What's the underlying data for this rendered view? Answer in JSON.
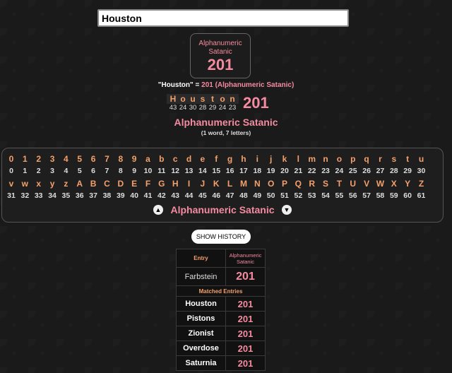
{
  "search": {
    "value": "Houston"
  },
  "cipher_box": {
    "name": "Alphanumeric Satanic",
    "value": "201"
  },
  "equation": {
    "phrase": "\"Houston\"",
    "equals": " = ",
    "result": "201 (Alphanumeric Satanic)"
  },
  "breakdown": {
    "letters": [
      "H",
      "o",
      "u",
      "s",
      "t",
      "o",
      "n"
    ],
    "values": [
      "43",
      "24",
      "30",
      "28",
      "29",
      "24",
      "23"
    ],
    "total": "201"
  },
  "cipher_name": "Alphanumeric Satanic",
  "word_count": "(1 word, 7 letters)",
  "chart": {
    "row1_chars": [
      "0",
      "1",
      "2",
      "3",
      "4",
      "5",
      "6",
      "7",
      "8",
      "9",
      "a",
      "b",
      "c",
      "d",
      "e",
      "f",
      "g",
      "h",
      "i",
      "j",
      "k",
      "l",
      "m",
      "n",
      "o",
      "p",
      "q",
      "r",
      "s",
      "t",
      "u"
    ],
    "row1_vals": [
      "0",
      "1",
      "2",
      "3",
      "4",
      "5",
      "6",
      "7",
      "8",
      "9",
      "10",
      "11",
      "12",
      "13",
      "14",
      "15",
      "16",
      "17",
      "18",
      "19",
      "20",
      "21",
      "22",
      "23",
      "24",
      "25",
      "26",
      "27",
      "28",
      "29",
      "30"
    ],
    "row2_chars": [
      "v",
      "w",
      "x",
      "y",
      "z",
      "A",
      "B",
      "C",
      "D",
      "E",
      "F",
      "G",
      "H",
      "I",
      "J",
      "K",
      "L",
      "M",
      "N",
      "O",
      "P",
      "Q",
      "R",
      "S",
      "T",
      "U",
      "V",
      "W",
      "X",
      "Y",
      "Z"
    ],
    "row2_vals": [
      "31",
      "32",
      "33",
      "34",
      "35",
      "36",
      "37",
      "38",
      "39",
      "40",
      "41",
      "42",
      "43",
      "44",
      "45",
      "46",
      "47",
      "48",
      "49",
      "50",
      "51",
      "52",
      "53",
      "54",
      "55",
      "56",
      "57",
      "58",
      "59",
      "60",
      "61"
    ],
    "title": "Alphanumeric Satanic",
    "prev_icon": "chevron-up-icon",
    "next_icon": "chevron-down-icon"
  },
  "history_button": "SHOW HISTORY",
  "history": {
    "col_entry": "Entry",
    "col_cipher": "Alphanumeric Satanic",
    "main": {
      "word": "Farbstein",
      "value": "201"
    },
    "matched_label": "Matched Entries",
    "matches": [
      {
        "word": "Houston",
        "value": "201"
      },
      {
        "word": "Pistons",
        "value": "201"
      },
      {
        "word": "Zionist",
        "value": "201"
      },
      {
        "word": "Overdose",
        "value": "201"
      },
      {
        "word": "Saturnia",
        "value": "201"
      }
    ]
  },
  "colors": {
    "pink": "#f48ba0",
    "orange": "#f4a06c",
    "background": "#1a1a1a"
  }
}
